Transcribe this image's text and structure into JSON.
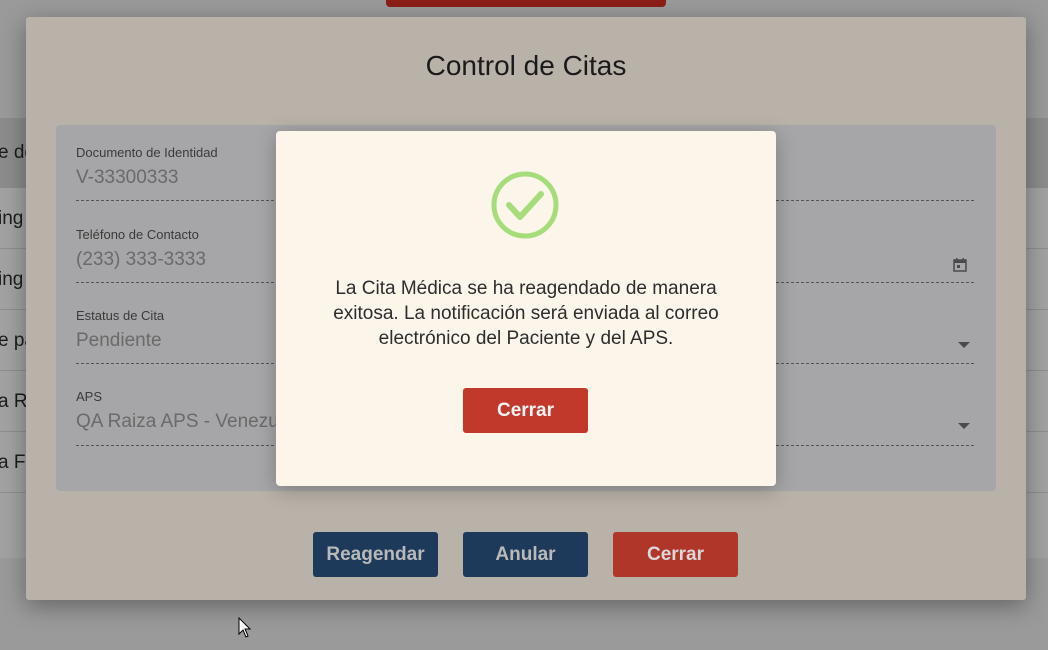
{
  "background": {
    "rows": [
      "e de",
      "ing",
      "ing",
      "e pa",
      "a R",
      "a F"
    ]
  },
  "modal": {
    "title": "Control de Citas",
    "fields": {
      "documento": {
        "label": "Documento de Identidad",
        "value": "V-33300333"
      },
      "telefono": {
        "label": "Teléfono de Contacto",
        "value": "(233) 333-3333"
      },
      "estatus": {
        "label": "Estatus de Cita",
        "value": "Pendiente"
      },
      "aps": {
        "label": "APS",
        "value": "QA Raiza APS - Venezu"
      }
    },
    "buttons": {
      "reagendar": "Reagendar",
      "anular": "Anular",
      "cerrar": "Cerrar"
    }
  },
  "dialog": {
    "icon": "check-circle-icon",
    "message": "La Cita Médica se ha reagendado de manera exitosa. La notificación será enviada al correo electrónico del Paciente y del APS.",
    "button": "Cerrar"
  },
  "colors": {
    "navy": "#1e3a5a",
    "red": "#c0392b",
    "success_green": "#a6dd7a"
  }
}
